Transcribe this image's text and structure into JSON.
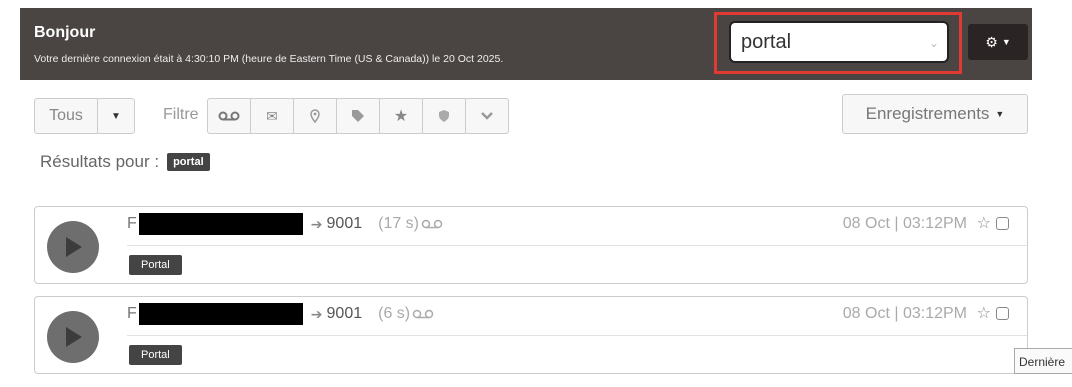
{
  "header": {
    "title": "Bonjour",
    "last_login": "Votre dernière connexion était à 4:30:10 PM (heure de Eastern Time (US & Canada)) le 20 Oct 2025.",
    "search_value": "portal"
  },
  "toolbar": {
    "all_label": "Tous",
    "filter_label": "Filtre",
    "records_label": "Enregistrements"
  },
  "results": {
    "label": "Résultats pour :",
    "query_tag": "portal"
  },
  "calls": [
    {
      "caller_prefix": "F",
      "destination": "9001",
      "duration": "(17 s)",
      "date": "08 Oct | 03:12PM",
      "tag": "Portal"
    },
    {
      "caller_prefix": "F",
      "destination": "9001",
      "duration": "(6 s)",
      "date": "08 Oct | 03:12PM",
      "tag": "Portal"
    }
  ],
  "tooltip": "Dernière",
  "icons": [
    "gear-icon",
    "voicemail-icon",
    "mail-icon",
    "location-icon",
    "tag-icon",
    "star-icon",
    "shield-icon",
    "chevron-down-icon",
    "play-icon",
    "arrow-right-icon"
  ],
  "colors": {
    "header_bg": "#4a4442",
    "highlight": "#e03a33",
    "tag_bg": "#444444"
  }
}
